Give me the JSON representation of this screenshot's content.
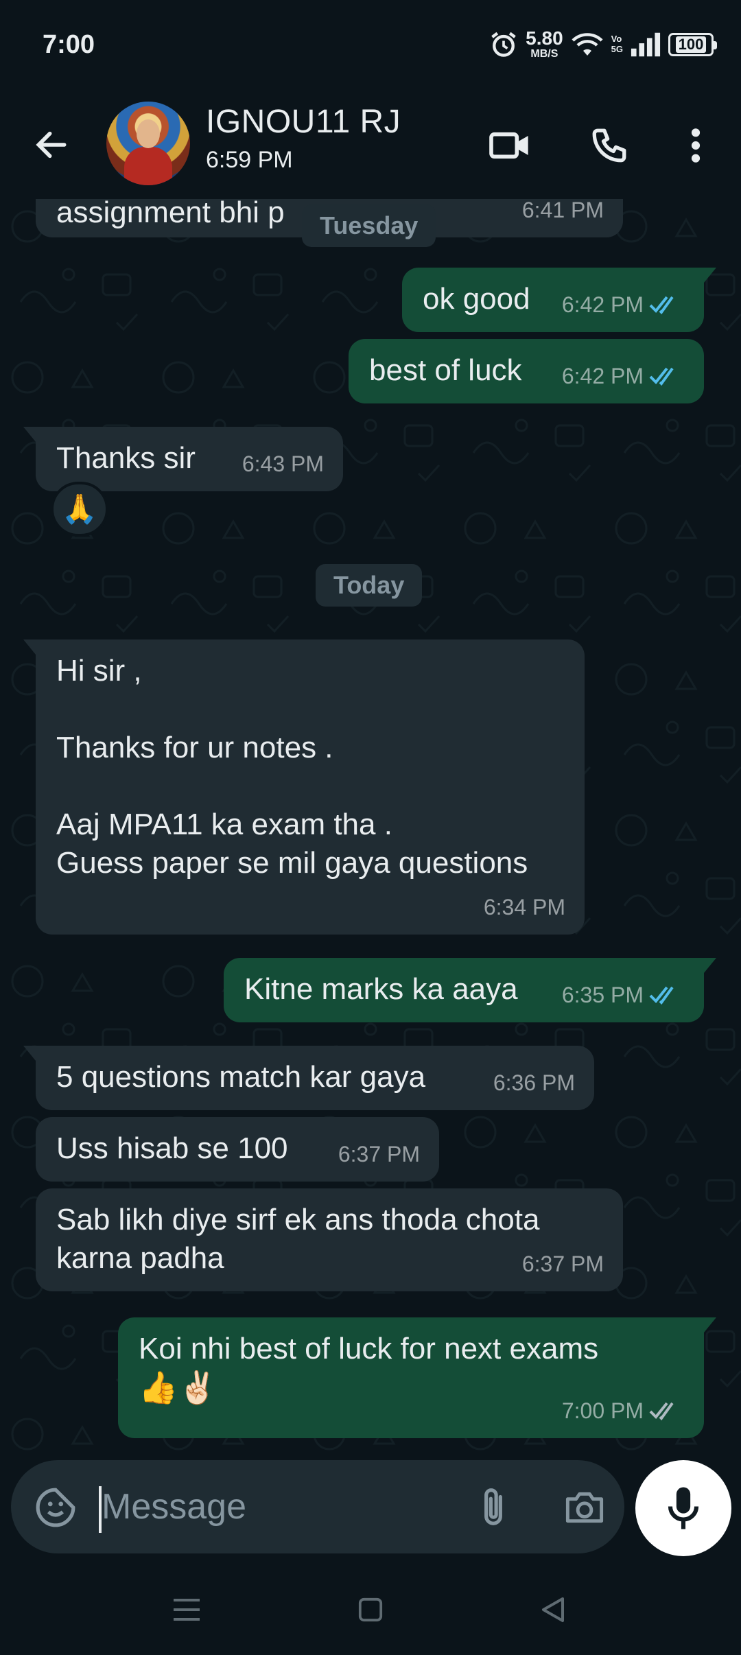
{
  "status_bar": {
    "time": "7:00",
    "net_speed_value": "5.80",
    "net_speed_unit": "MB/S",
    "volte_top": "Vo",
    "volte_bottom": "5G",
    "battery": "100"
  },
  "header": {
    "contact_name": "IGNOU11 RJ",
    "contact_status": "6:59 PM"
  },
  "colors": {
    "background": "#0b141a",
    "incoming_bubble": "#202c33",
    "outgoing_bubble": "#144d37",
    "read_tick": "#53bdeb",
    "delivered_tick": "#aebac1"
  },
  "chat": {
    "date_tuesday": "Tuesday",
    "date_today": "Today",
    "messages": [
      {
        "direction": "in",
        "text": "assignment bhi p",
        "time": "6:41 PM"
      },
      {
        "direction": "out",
        "text": "ok good",
        "time": "6:42 PM",
        "ticks": "read"
      },
      {
        "direction": "out",
        "text": "best of luck",
        "time": "6:42 PM",
        "ticks": "read"
      },
      {
        "direction": "in",
        "text": "Thanks sir",
        "time": "6:43 PM",
        "reaction": "🙏"
      },
      {
        "direction": "in",
        "text": "Hi sir ,\n\nThanks for ur notes .\n\nAaj MPA11 ka exam tha .\nGuess paper se mil gaya questions",
        "time": "6:34 PM"
      },
      {
        "direction": "out",
        "text": "Kitne marks ka aaya",
        "time": "6:35 PM",
        "ticks": "read"
      },
      {
        "direction": "in",
        "text": "5 questions match kar gaya",
        "time": "6:36 PM"
      },
      {
        "direction": "in",
        "text": "Uss hisab se 100",
        "time": "6:37 PM"
      },
      {
        "direction": "in",
        "text": "Sab likh diye sirf ek ans thoda chota\nkarna padha",
        "time": "6:37 PM"
      },
      {
        "direction": "out",
        "text": "Koi nhi best of luck for next exams",
        "emoji_line": "👍✌🏻",
        "time": "7:00 PM",
        "ticks": "delivered"
      }
    ]
  },
  "input": {
    "placeholder": "Message"
  },
  "icons": {
    "back": "arrow-left-icon",
    "video": "video-call-icon",
    "call": "phone-icon",
    "menu": "more-vert-icon",
    "sticker": "sticker-icon",
    "attach": "paperclip-icon",
    "camera": "camera-icon",
    "mic": "mic-icon"
  }
}
